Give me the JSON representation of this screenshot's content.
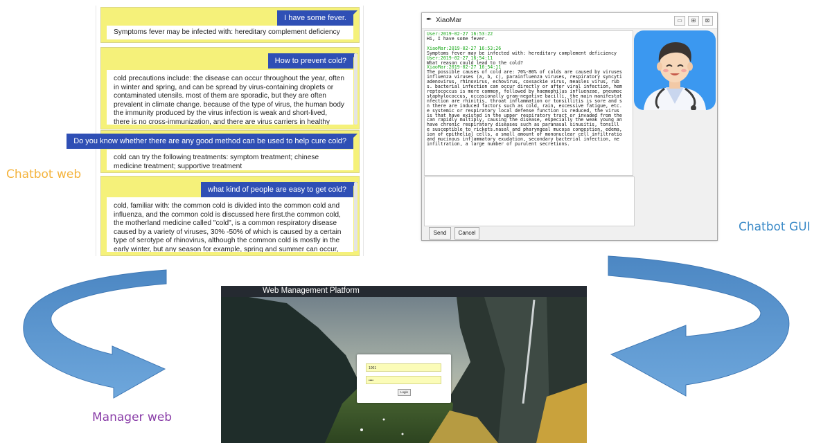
{
  "labels": {
    "chatbot_web": "Chatbot web",
    "chatbot_gui": "Chatbot GUI",
    "manager_web": "Manager web"
  },
  "colors": {
    "chatbot_web_label": "#f4b33c",
    "chatbot_gui_label": "#3c8bc8",
    "manager_web_label": "#8a3ea8",
    "chat_block_bg": "#f5f17a",
    "user_bubble": "#2f4fb5",
    "arrow_blue": "#5b9bd5"
  },
  "chatbot_web": {
    "messages": [
      {
        "user": "I have some fever.",
        "bot": "Symptoms fever may be infected with: hereditary complement deficiency"
      },
      {
        "user": "How to prevent cold?",
        "bot": "cold precautions include: the disease can occur throughout the year, often in winter and spring, and can be spread by virus-containing droplets or contaminated utensils. most of them are sporadic, but they are often prevalent in climate change. because of the type of virus, the human body the immunity produced by the virus infection is weak and short-lived, there is no cross-immunization, and there are virus carriers in healthy"
      },
      {
        "user": "Do you know whether there are any good method can be used to help cure cold?",
        "bot": "cold can try the following treatments: symptom treatment; chinese medicine treatment; supportive treatment"
      },
      {
        "user": "what kind of people are easy to get cold?",
        "bot": "cold, familiar with: the common cold is divided into the common cold and influenza, and the common cold is discussed here first.the common cold, the motherland medicine called \"cold\", is a common respiratory disease caused by a variety of viruses, 30% -50% of which is caused by a certain type of serotype of rhinovirus, although the common cold is mostly in the early winter, but any season for example, spring and summer can occur, and the virus of the cold in different seasons is not exactly the"
      }
    ]
  },
  "chatbot_gui": {
    "title": "XiaoMar",
    "window_buttons": [
      "▭",
      "⊞",
      "⊠"
    ],
    "log": [
      {
        "ts": "User:2019-02-27 16:53:22",
        "text": [
          "Hi, I have some fever."
        ]
      },
      {
        "ts": "XiaoMar:2019-02-27 16:53:26",
        "text": [
          "Symptoms fever may be infected with: hereditary complement deficiency"
        ]
      },
      {
        "ts": " User:2019-02-27 16:54:11",
        "text": [
          "What reason could lead to the cold?"
        ]
      },
      {
        "ts": "XiaoMar:2019-02-27 16:54:11",
        "text": [
          "The possible causes of cold are: 70%-80% of colds are caused by viruses",
          "influenza viruses (a, b, c), parainfluenza viruses, respiratory syncyti",
          " adenovirus, rhinovirus, echovirus, coxsackie virus, measles virus, rub",
          "s. bacterial infection can occur directly or after viral infection, hem",
          "reptococcus is more common, followed by haemophilus influenzae, pneumoc",
          "staphylococcus, occasionally gram-negative bacilli. the main manifestat",
          "nfection are rhinitis, throat inflammation or tonsillitis is sore and s",
          "n there are induced factors such as cold, rain, excessive fatigue, etc.",
          "e systemic or respiratory local defense function is reduced, the virus ",
          "is that have existed in the upper respiratory tract or invaded from the",
          "can rapidly multiply, causing the disease, especially the weak young an",
          " have chronic respiratory diseases such as paranasal sinusitis, tonsill",
          "e susceptible to rickets.nasal and pharyngeal mucosa congestion, edema,",
          "ion of epithelial cells, a small amount of mononuclear cell infiltratio",
          " and mucinous inflammatory exudation, secondary bacterial infection, ne",
          "infiltration, a large number of purulent secretions."
        ]
      }
    ],
    "send_label": "Send",
    "cancel_label": "Cancel"
  },
  "manager_web": {
    "title": "Web Management Platform",
    "username_value": "1001",
    "password_value": "••••",
    "login_label": "Login"
  }
}
